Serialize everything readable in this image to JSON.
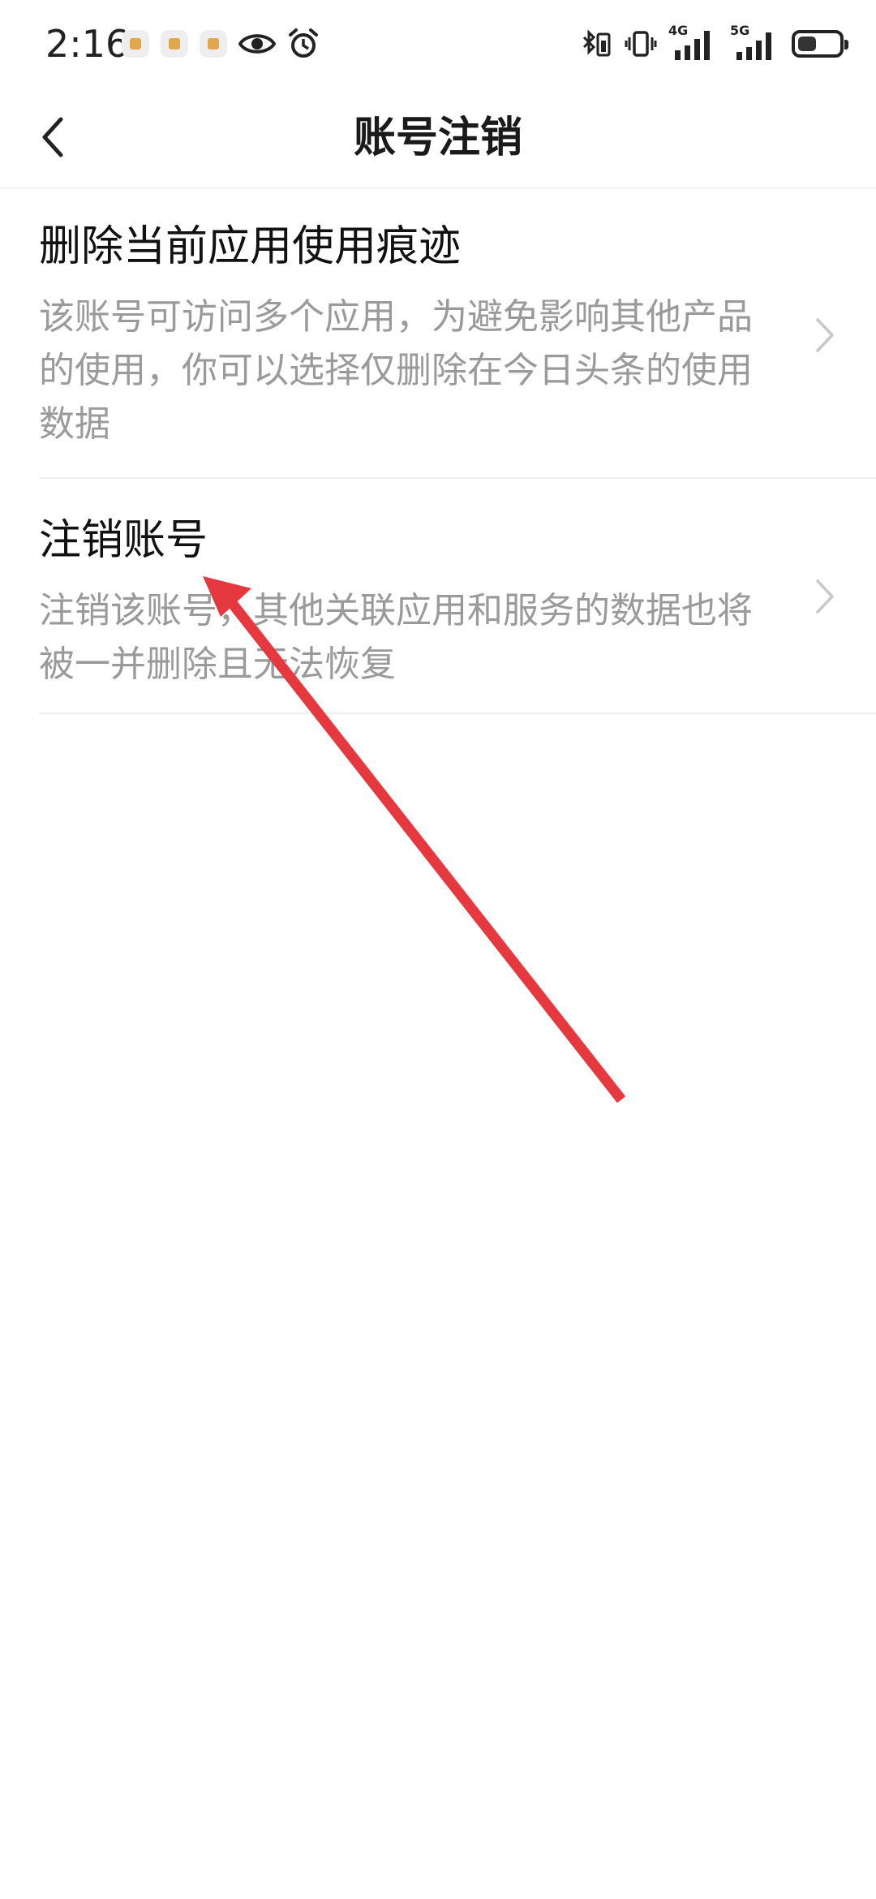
{
  "status_bar": {
    "time": "2:16",
    "network_4g": "4G",
    "network_5g": "5G",
    "battery_level": 0.45,
    "icons": [
      "notification-icon",
      "notification-icon",
      "notification-icon",
      "eye-icon",
      "alarm-icon",
      "bluetooth-battery-icon",
      "vibrate-icon",
      "signal-4g-icon",
      "signal-5g-icon",
      "battery-icon"
    ]
  },
  "header": {
    "title": "账号注销",
    "back_icon": "chevron-left-icon"
  },
  "options": [
    {
      "title": "删除当前应用使用痕迹",
      "description": "该账号可访问多个应用，为避免影响其他产品的使用，你可以选择仅删除在今日头条的使用数据",
      "icon": "chevron-right-icon"
    },
    {
      "title": "注销账号",
      "description": "注销该账号，其他关联应用和服务的数据也将被一并删除且无法恢复",
      "icon": "chevron-right-icon"
    }
  ],
  "colors": {
    "annotation_arrow": "#e5393f",
    "description_text": "#9a9a9a",
    "divider": "#f0f0f0"
  }
}
